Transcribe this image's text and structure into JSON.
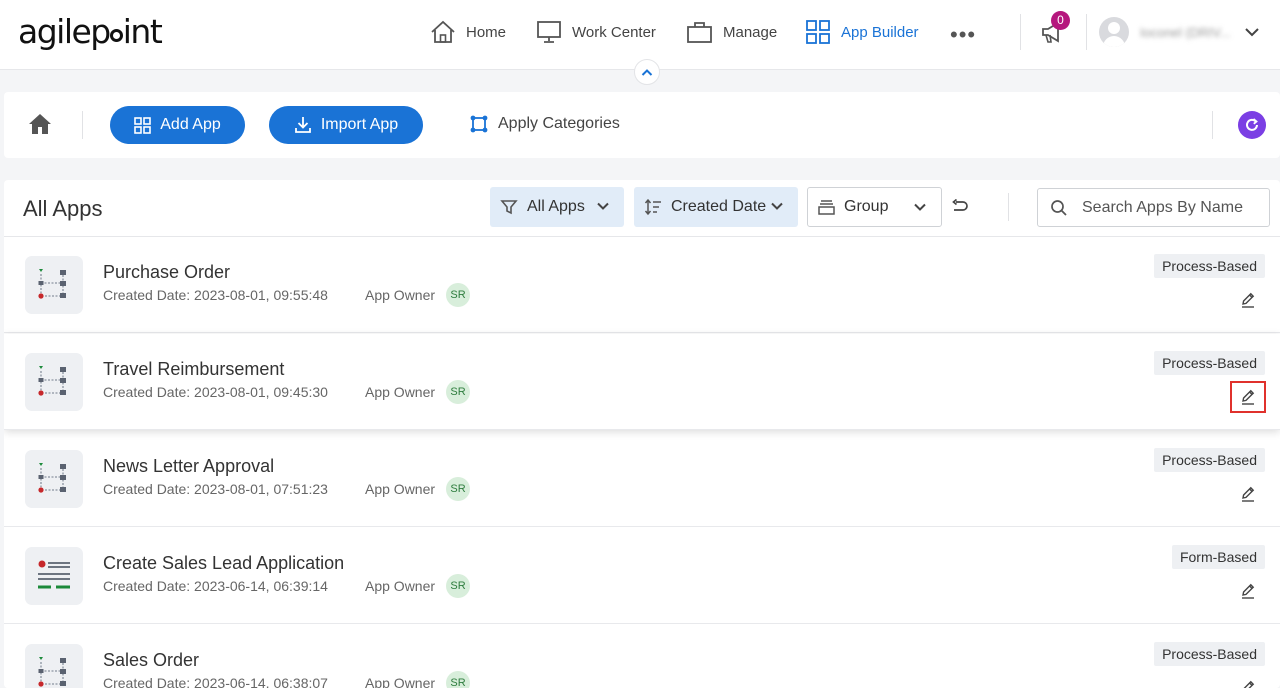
{
  "brand": {
    "logo_before": "agilep",
    "logo_after": "int"
  },
  "nav": {
    "home": "Home",
    "work_center": "Work Center",
    "manage": "Manage",
    "app_builder": "App Builder",
    "more": "•••",
    "notification_count": "0",
    "username": "Ioconel (DRIV..."
  },
  "toolbar": {
    "add_app": "Add App",
    "import_app": "Import App",
    "apply_categories": "Apply Categories"
  },
  "panel": {
    "title": "All Apps",
    "filter_all_apps": "All Apps",
    "sort_created_date": "Created Date",
    "group": "Group",
    "search_placeholder": "Search Apps By Name"
  },
  "apps": [
    {
      "name": "Purchase Order",
      "created": "Created Date: 2023-08-01, 09:55:48",
      "owner_label": "App Owner",
      "owner_initials": "SR",
      "type": "Process-Based",
      "icon": "process-icon"
    },
    {
      "name": "Travel Reimbursement",
      "created": "Created Date: 2023-08-01, 09:45:30",
      "owner_label": "App Owner",
      "owner_initials": "SR",
      "type": "Process-Based",
      "icon": "process-icon"
    },
    {
      "name": "News Letter Approval",
      "created": "Created Date: 2023-08-01, 07:51:23",
      "owner_label": "App Owner",
      "owner_initials": "SR",
      "type": "Process-Based",
      "icon": "process-icon"
    },
    {
      "name": "Create Sales Lead Application",
      "created": "Created Date: 2023-06-14, 06:39:14",
      "owner_label": "App Owner",
      "owner_initials": "SR",
      "type": "Form-Based",
      "icon": "form-icon"
    },
    {
      "name": "Sales Order",
      "created": "Created Date: 2023-06-14, 06:38:07",
      "owner_label": "App Owner",
      "owner_initials": "SR",
      "type": "Process-Based",
      "icon": "process-icon"
    }
  ],
  "colors": {
    "accent": "#1a73d6",
    "badge": "#b5177d",
    "refresh": "#7b3fe4",
    "highlight_box": "#e0312c"
  }
}
